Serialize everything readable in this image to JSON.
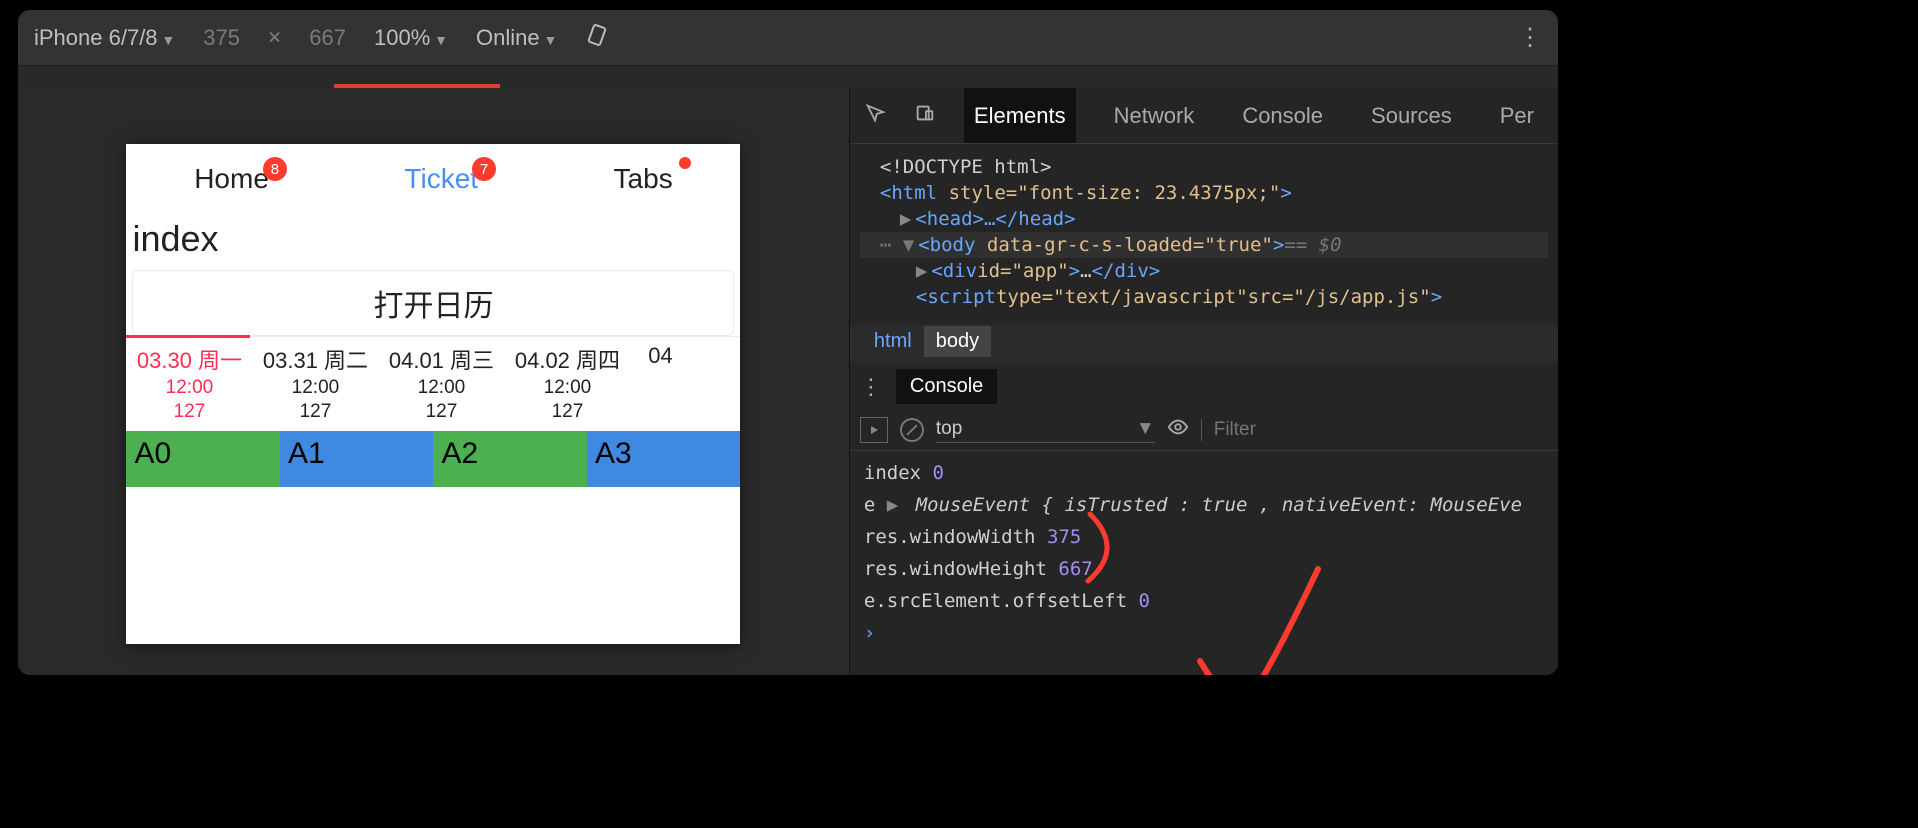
{
  "toolbar": {
    "device": "iPhone 6/7/8",
    "width": "375",
    "sep": "×",
    "height": "667",
    "zoom": "100%",
    "throttling": "Online"
  },
  "devtools": {
    "tabs": [
      "Elements",
      "Network",
      "Console",
      "Sources",
      "Per"
    ],
    "active_tab": "Elements",
    "crumbs": [
      "html",
      "body"
    ],
    "active_crumb": "body",
    "drawer_tab": "Console",
    "console_scope": "top",
    "filter_placeholder": "Filter"
  },
  "dom": {
    "doctype": "<!DOCTYPE html>",
    "html_open": "<html",
    "html_style_attr": "style=",
    "html_style_val": "\"font-size: 23.4375px;\"",
    "html_open_end": ">",
    "head": "<head>…</head>",
    "body_open": "<body",
    "body_attr": "data-gr-c-s-loaded=",
    "body_attr_val": "\"true\"",
    "body_open_end": ">",
    "body_sel": " == $0",
    "div_app": "<div id=\"app\">…</div>",
    "script_line": "<script type=\"text/javascript\" src=\"/js/app.js\">"
  },
  "app": {
    "tabs": [
      {
        "label": "Home",
        "badge": "8",
        "active": false
      },
      {
        "label": "Ticket",
        "badge": "7",
        "active": true
      },
      {
        "label": "Tabs",
        "badge": "",
        "dot": true,
        "active": false
      }
    ],
    "section": "index",
    "open_calendar": "打开日历",
    "dates": [
      {
        "d": "03.30 周一",
        "t": "12:00",
        "n": "127",
        "active": true
      },
      {
        "d": "03.31 周二",
        "t": "12:00",
        "n": "127"
      },
      {
        "d": "04.01 周三",
        "t": "12:00",
        "n": "127"
      },
      {
        "d": "04.02 周四",
        "t": "12:00",
        "n": "127"
      },
      {
        "d": "04",
        "t": "",
        "n": ""
      }
    ],
    "blocks": [
      "A0",
      "A1",
      "A2",
      "A3"
    ]
  },
  "console": {
    "l1a": "index ",
    "l1b": "0",
    "l2a": "e ",
    "l2b": "MouseEvent {",
    "l2c": "isTrusted",
    "l2d": ": ",
    "l2e": "true",
    "l2f": ", nativeEvent: MouseEve",
    "l3a": "res.windowWidth ",
    "l3b": "375",
    "l4a": "res.windowHeight ",
    "l4b": "667",
    "l5a": "e.srcElement.offsetLeft ",
    "l5b": "0"
  }
}
